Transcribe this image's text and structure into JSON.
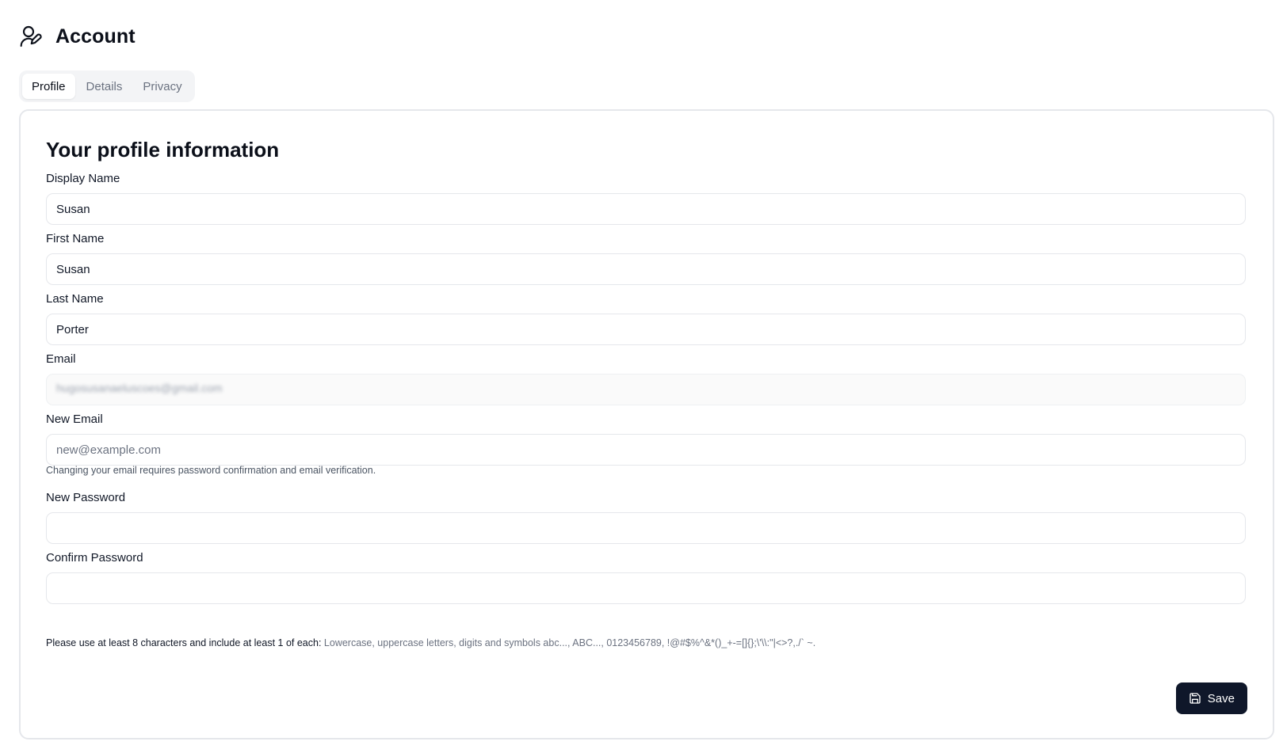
{
  "header": {
    "icon": "user-pen-icon",
    "title": "Account"
  },
  "tabs": [
    {
      "label": "Profile",
      "active": true
    },
    {
      "label": "Details",
      "active": false
    },
    {
      "label": "Privacy",
      "active": false
    }
  ],
  "card": {
    "title": "Your profile information",
    "fields": {
      "display_name": {
        "label": "Display Name",
        "value": "Susan"
      },
      "first_name": {
        "label": "First Name",
        "value": "Susan"
      },
      "last_name": {
        "label": "Last Name",
        "value": "Porter"
      },
      "email": {
        "label": "Email",
        "value": "hugosusanaeluscoes@gmail.com",
        "disabled": true,
        "redacted": true
      },
      "new_email": {
        "label": "New Email",
        "value": "",
        "placeholder": "new@example.com"
      },
      "new_email_hint": "Changing your email requires password confirmation and email verification.",
      "new_password": {
        "label": "New Password",
        "value": ""
      },
      "confirm_password": {
        "label": "Confirm Password",
        "value": ""
      }
    },
    "password_hint": {
      "lead": "Please use at least 8 characters and include at least 1 of each:",
      "detail": " Lowercase, uppercase letters, digits and symbols abc..., ABC..., 0123456789, !@#$%^&*()_+-=[]{};\\'\\\\:\"|<>?,./` ~."
    },
    "save_label": "Save",
    "save_icon": "save-icon"
  },
  "colors": {
    "primary_button": "#0f172a",
    "border": "#e5e7eb",
    "tabs_background": "#f3f4f6"
  }
}
